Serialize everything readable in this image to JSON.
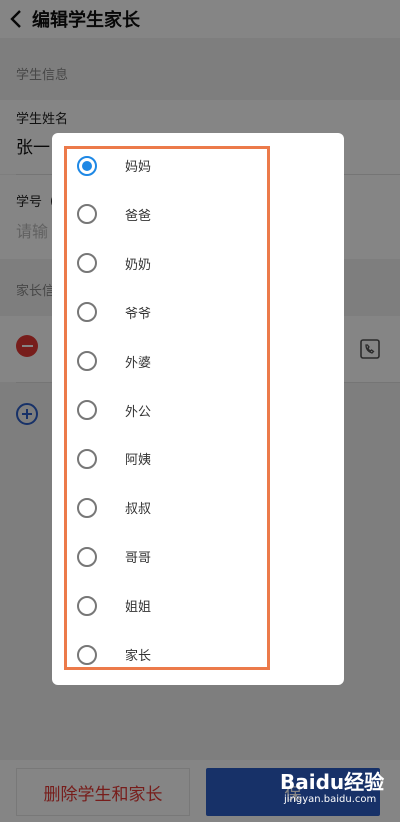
{
  "header": {
    "title": "编辑学生家长"
  },
  "student_section": {
    "heading": "学生信息",
    "name_label": "学生姓名",
    "name_value": "张一",
    "id_label": "学号（",
    "id_placeholder": "请输"
  },
  "parent_section": {
    "heading": "家长信"
  },
  "dialog": {
    "options": [
      {
        "label": "妈妈",
        "checked": true
      },
      {
        "label": "爸爸",
        "checked": false
      },
      {
        "label": "奶奶",
        "checked": false
      },
      {
        "label": "爷爷",
        "checked": false
      },
      {
        "label": "外婆",
        "checked": false
      },
      {
        "label": "外公",
        "checked": false
      },
      {
        "label": "阿姨",
        "checked": false
      },
      {
        "label": "叔叔",
        "checked": false
      },
      {
        "label": "哥哥",
        "checked": false
      },
      {
        "label": "姐姐",
        "checked": false
      },
      {
        "label": "家长",
        "checked": false
      }
    ]
  },
  "bottom": {
    "delete_label": "删除学生和家长",
    "save_label": "保"
  },
  "watermark": {
    "logo": "Baidu经验",
    "site": "jingyan.baidu.com"
  },
  "colors": {
    "accent": "#2d5fc8",
    "danger": "#e53935",
    "radio": "#1e88e5",
    "highlight": "#ec7a4a"
  }
}
